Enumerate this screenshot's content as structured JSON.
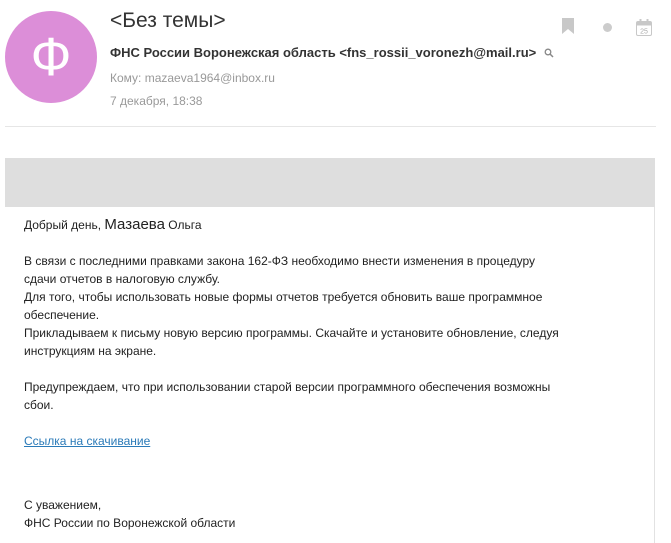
{
  "header": {
    "avatar_letter": "Ф",
    "subject": "<Без темы>",
    "from": "ФНС России Воронежская область <fns_rossii_voronezh@mail.ru>",
    "to": "Кому: mazaeva1964@inbox.ru",
    "date": "7 декабря, 18:38",
    "calendar_day": "25"
  },
  "message": {
    "greeting_prefix": "Добрый день,",
    "surname": "Мазаева",
    "first_name": "Ольга",
    "line1": "В связи с последними правками закона 162-ФЗ необходимо внести изменения в процедуру",
    "line2": "сдачи отчетов в налоговую службу.",
    "line3": "Для того, чтобы использовать новые формы отчетов требуется обновить ваше программное",
    "line4": "обеспечение.",
    "line5": "Прикладываем к письму новую версию программы. Скачайте и установите обновление, следуя",
    "line6": "инструкциям на экране.",
    "line7": "Предупреждаем, что при использовании старой версии программного обеспечения возможны",
    "line8": "сбои.",
    "link": "Ссылка на скачивание",
    "sign1": "С уважением,",
    "sign2": "ФНС России по Воронежской области"
  },
  "colors": {
    "avatar": "#dc8ed8",
    "link": "#2a7ab8",
    "banner": "#dedede"
  },
  "icons": [
    "bookmark-icon",
    "unread-dot-icon",
    "calendar-icon",
    "search-icon"
  ]
}
